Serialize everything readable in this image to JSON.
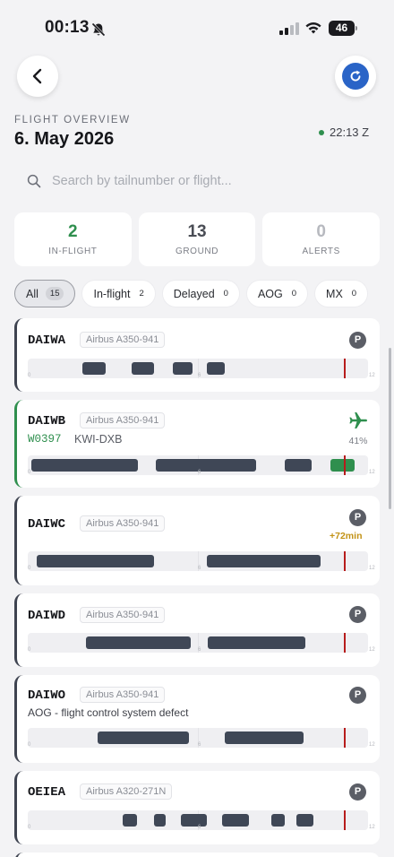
{
  "status_bar": {
    "time": "00:13",
    "battery": "46"
  },
  "header": {
    "overview_label": "FLIGHT OVERVIEW",
    "date": "6. May 2026",
    "utc_time": "22:13 Z"
  },
  "search": {
    "placeholder": "Search by tailnumber or flight..."
  },
  "stats": [
    {
      "value": "2",
      "label": "IN-FLIGHT",
      "color": "#2f8f4e"
    },
    {
      "value": "13",
      "label": "GROUND",
      "color": "#4a4d55"
    },
    {
      "value": "0",
      "label": "ALERTS",
      "color": "#b7b9bf"
    }
  ],
  "filters": [
    {
      "label": "All",
      "count": "15",
      "active": true
    },
    {
      "label": "In-flight",
      "count": "2"
    },
    {
      "label": "Delayed",
      "count": "0"
    },
    {
      "label": "AOG",
      "count": "0"
    },
    {
      "label": "MX",
      "count": "0"
    }
  ],
  "timeline_ticks": [
    "0",
    "6",
    "12"
  ],
  "timeline_now": 0.93,
  "aircraft": [
    {
      "tail": "DAIWA",
      "type": "Airbus A350-941",
      "status": "parked",
      "badge": "P",
      "segments": [
        [
          0.16,
          0.23
        ],
        [
          0.305,
          0.37
        ],
        [
          0.425,
          0.485
        ],
        [
          0.525,
          0.58
        ]
      ]
    },
    {
      "tail": "DAIWB",
      "type": "Airbus A350-941",
      "status": "inflight",
      "flight": "W0397",
      "route": "KWI-DXB",
      "progress": "41%",
      "segments": [
        [
          0.01,
          0.325
        ],
        [
          0.375,
          0.67
        ],
        [
          0.755,
          0.835
        ]
      ],
      "active_segment": [
        0.89,
        0.96
      ]
    },
    {
      "tail": "DAIWC",
      "type": "Airbus A350-941",
      "status": "parked",
      "badge": "P",
      "delay": "+72min",
      "segments": [
        [
          0.025,
          0.37
        ],
        [
          0.525,
          0.86
        ]
      ]
    },
    {
      "tail": "DAIWD",
      "type": "Airbus A350-941",
      "status": "parked",
      "badge": "P",
      "segments": [
        [
          0.17,
          0.48
        ],
        [
          0.53,
          0.815
        ]
      ]
    },
    {
      "tail": "DAIWO",
      "type": "Airbus A350-941",
      "status": "parked",
      "badge": "P",
      "note": "AOG - flight control system defect",
      "segments": [
        [
          0.205,
          0.475
        ],
        [
          0.58,
          0.81
        ]
      ]
    },
    {
      "tail": "OEIEA",
      "type": "Airbus A320-271N",
      "status": "parked",
      "badge": "P",
      "segments": [
        [
          0.28,
          0.32
        ],
        [
          0.37,
          0.405
        ],
        [
          0.45,
          0.525
        ],
        [
          0.57,
          0.65
        ],
        [
          0.715,
          0.755
        ],
        [
          0.79,
          0.84
        ]
      ]
    }
  ]
}
